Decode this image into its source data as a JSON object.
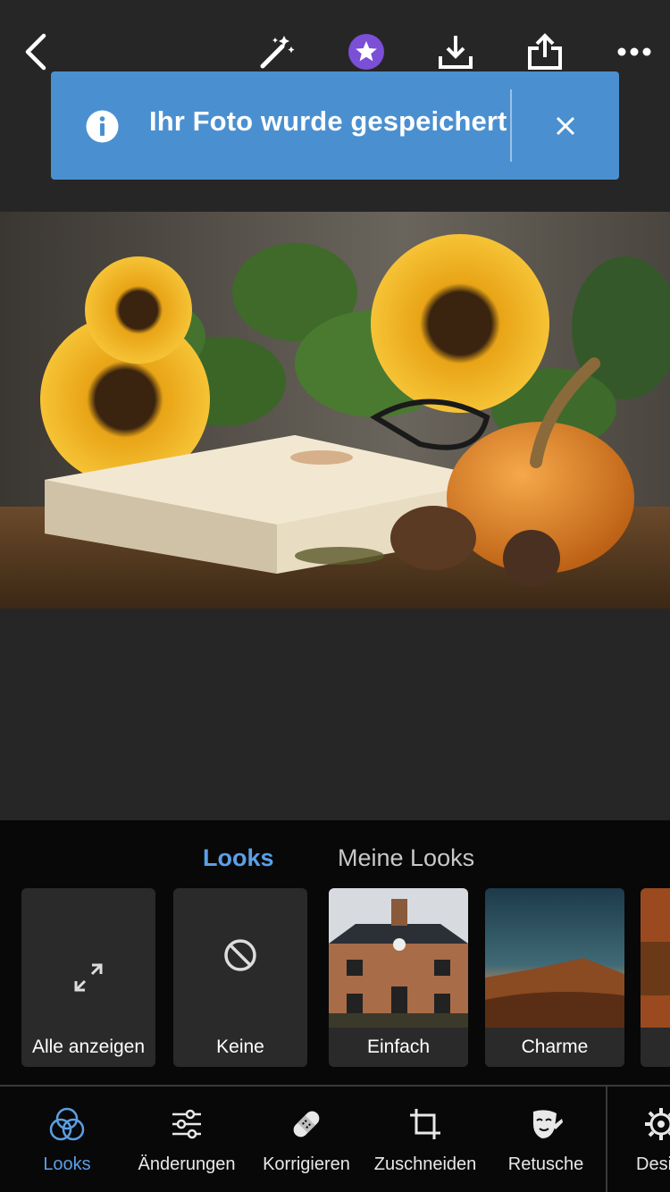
{
  "toolbar": {
    "icons": [
      "back-arrow-icon",
      "magic-wand-icon",
      "premium-star-icon",
      "download-icon",
      "share-icon",
      "more-options-icon"
    ]
  },
  "toast": {
    "message": "Ihr Foto wurde gespeichert",
    "icon": "info-icon",
    "close_icon": "close-icon"
  },
  "looks_panel": {
    "tabs": [
      {
        "label": "Looks",
        "active": true
      },
      {
        "label": "Meine Looks",
        "active": false
      }
    ],
    "cards": [
      {
        "label": "Alle anzeigen",
        "icon": "expand-arrows-icon"
      },
      {
        "label": "Keine",
        "icon": "none-circle-slash-icon"
      },
      {
        "label": "Einfach",
        "thumb": "house-photo"
      },
      {
        "label": "Charme",
        "thumb": "mountain-dusk-photo"
      }
    ]
  },
  "bottom_nav": {
    "items": [
      {
        "label": "Looks",
        "icon": "looks-circles-icon",
        "active": true
      },
      {
        "label": "Änderungen",
        "icon": "sliders-icon",
        "active": false
      },
      {
        "label": "Korrigieren",
        "icon": "bandage-icon",
        "active": false
      },
      {
        "label": "Zuschneiden",
        "icon": "crop-icon",
        "active": false
      },
      {
        "label": "Retusche",
        "icon": "retouch-face-icon",
        "active": false
      },
      {
        "label": "Desi",
        "icon": "design-gear-icon",
        "active": false
      }
    ]
  },
  "colors": {
    "accent": "#5aa0e6",
    "toast_bg": "#4a90d0",
    "premium": "#7b4fd6",
    "background": "#262626",
    "panel": "#080808"
  }
}
